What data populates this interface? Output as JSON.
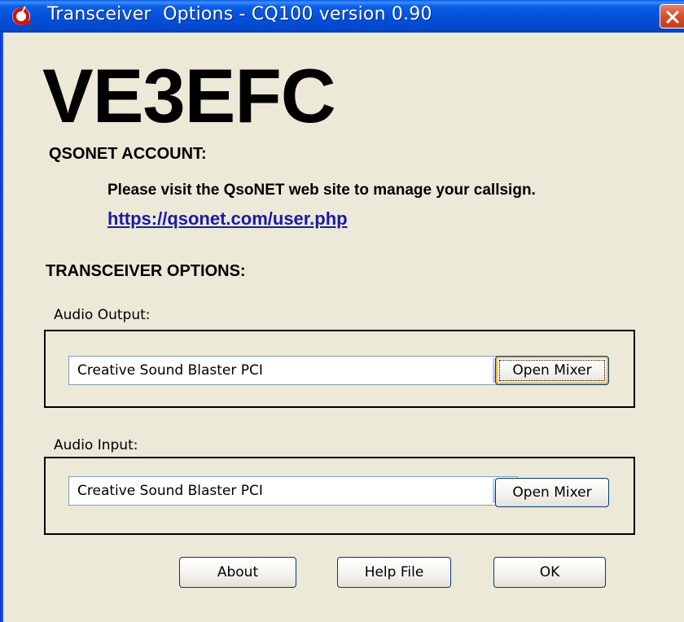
{
  "window": {
    "title": "Transceiver  Options - CQ100 version 0.90",
    "icon": "cq100-app-icon",
    "close_icon": "close-icon"
  },
  "account": {
    "callsign": "VE3EFC",
    "heading": "QSONET ACCOUNT:",
    "message": "Please visit the QsoNET web site to manage your callsign.",
    "link": "https://qsonet.com/user.php"
  },
  "transceiver": {
    "heading": "TRANSCEIVER OPTIONS:",
    "audio_output": {
      "label": "Audio Output:",
      "selected": "Creative Sound Blaster PCI",
      "mixer_button": "Open Mixer"
    },
    "audio_input": {
      "label": "Audio Input:",
      "selected": "Creative Sound Blaster PCI",
      "mixer_button": "Open Mixer"
    }
  },
  "buttons": {
    "about": "About",
    "help": "Help File",
    "ok": "OK"
  },
  "colors": {
    "titlebar": "#0450d8",
    "dialog_bg": "#ece9d8",
    "link": "#1a1aa6",
    "close_button": "#d6532f"
  }
}
